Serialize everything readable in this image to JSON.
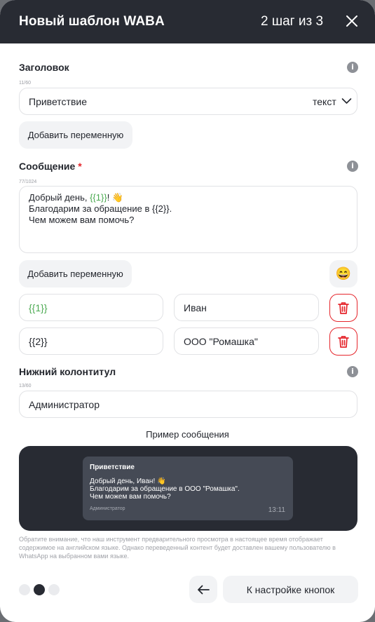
{
  "header": {
    "title": "Новый шаблон WABA",
    "step": "2 шаг из 3"
  },
  "heading": {
    "label": "Заголовок",
    "counter": "11/60",
    "value": "Приветствие",
    "type_select": "текст",
    "add_variable": "Добавить переменную"
  },
  "message": {
    "label": "Сообщение",
    "required_mark": "*",
    "counter": "77/1024",
    "line1_prefix": "Добрый день, ",
    "line1_var": "{{1}}",
    "line1_suffix": "! 👋",
    "line2": "Благодарим за обращение в {{2}}.",
    "line3": "Чем можем вам помочь?",
    "add_variable": "Добавить переменную",
    "emoji_button": "😄"
  },
  "variables": [
    {
      "name": "{{1}}",
      "value": "Иван"
    },
    {
      "name": "{{2}}",
      "value": "ООО \"Ромашка\""
    }
  ],
  "footer": {
    "label": "Нижний колонтитул",
    "counter": "13/60",
    "value": "Администратор"
  },
  "preview": {
    "title": "Пример сообщения",
    "bubble_title": "Приветствие",
    "line1": "Добрый день, Иван! 👋",
    "line2": "Благодарим за обращение в ООО \"Ромашка\".",
    "line3": "Чем можем вам помочь?",
    "footer": "Администратор",
    "time": "13:11"
  },
  "note": "Обратите внимание, что наш инструмент предварительного просмотра в настоящее время отображает содержимое на английском языке. Однако переведенный контент будет доставлен вашему пользователю в WhatsApp на выбранном вами языке.",
  "pagination": {
    "total": 3,
    "active": 2
  },
  "nav": {
    "next_label": "К настройке кнопок"
  },
  "icons": {
    "info": "i",
    "close": "close-icon",
    "back": "arrow-left-icon",
    "trash": "trash-icon",
    "chevron": "chevron-down-icon"
  },
  "colors": {
    "header_bg": "#282b33",
    "accent_green": "#4caa52",
    "danger": "#e5262c"
  }
}
